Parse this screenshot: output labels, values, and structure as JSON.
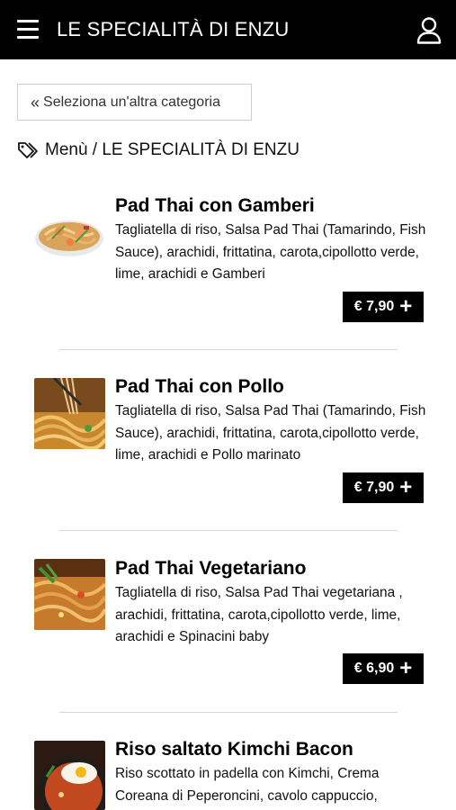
{
  "header": {
    "title": "LE SPECIALITÀ DI ENZU",
    "menu_icon": "hamburger-menu-icon",
    "user_icon": "user-icon"
  },
  "back_button": {
    "label": "Seleziona un'altra categoria",
    "icon": "double-chevron-left-icon"
  },
  "breadcrumb": {
    "icon": "tag-icon",
    "text": "Menù / LE SPECIALITÀ DI ENZU"
  },
  "items": [
    {
      "name": "Pad Thai con Gamberi",
      "description": "Tagliatella di riso, Salsa Pad Thai (Tamarindo, Fish Sauce), arachidi, frittatina, carota,cipollotto verde, lime, arachidi e Gamberi",
      "price": "€ 7,90"
    },
    {
      "name": "Pad Thai con Pollo",
      "description": "Tagliatella di riso, Salsa Pad Thai (Tamarindo, Fish Sauce), arachidi, frittatina, carota,cipollotto verde, lime, arachidi e Pollo marinato",
      "price": "€ 7,90"
    },
    {
      "name": "Pad Thai Vegetariano",
      "description": "Tagliatella di riso, Salsa Pad Thai vegetariana , arachidi, frittatina, carota,cipollotto verde, lime, arachidi e Spinacini baby",
      "price": "€ 6,90"
    },
    {
      "name": "Riso saltato Kimchi Bacon",
      "description": "Riso scottato in padella con Kimchi, Crema Coreana di Peperoncini, cavolo cappuccio,",
      "price": ""
    }
  ],
  "colors": {
    "header_bg": "#000000",
    "price_bg": "#000000",
    "divider": "#d6d6d6"
  }
}
